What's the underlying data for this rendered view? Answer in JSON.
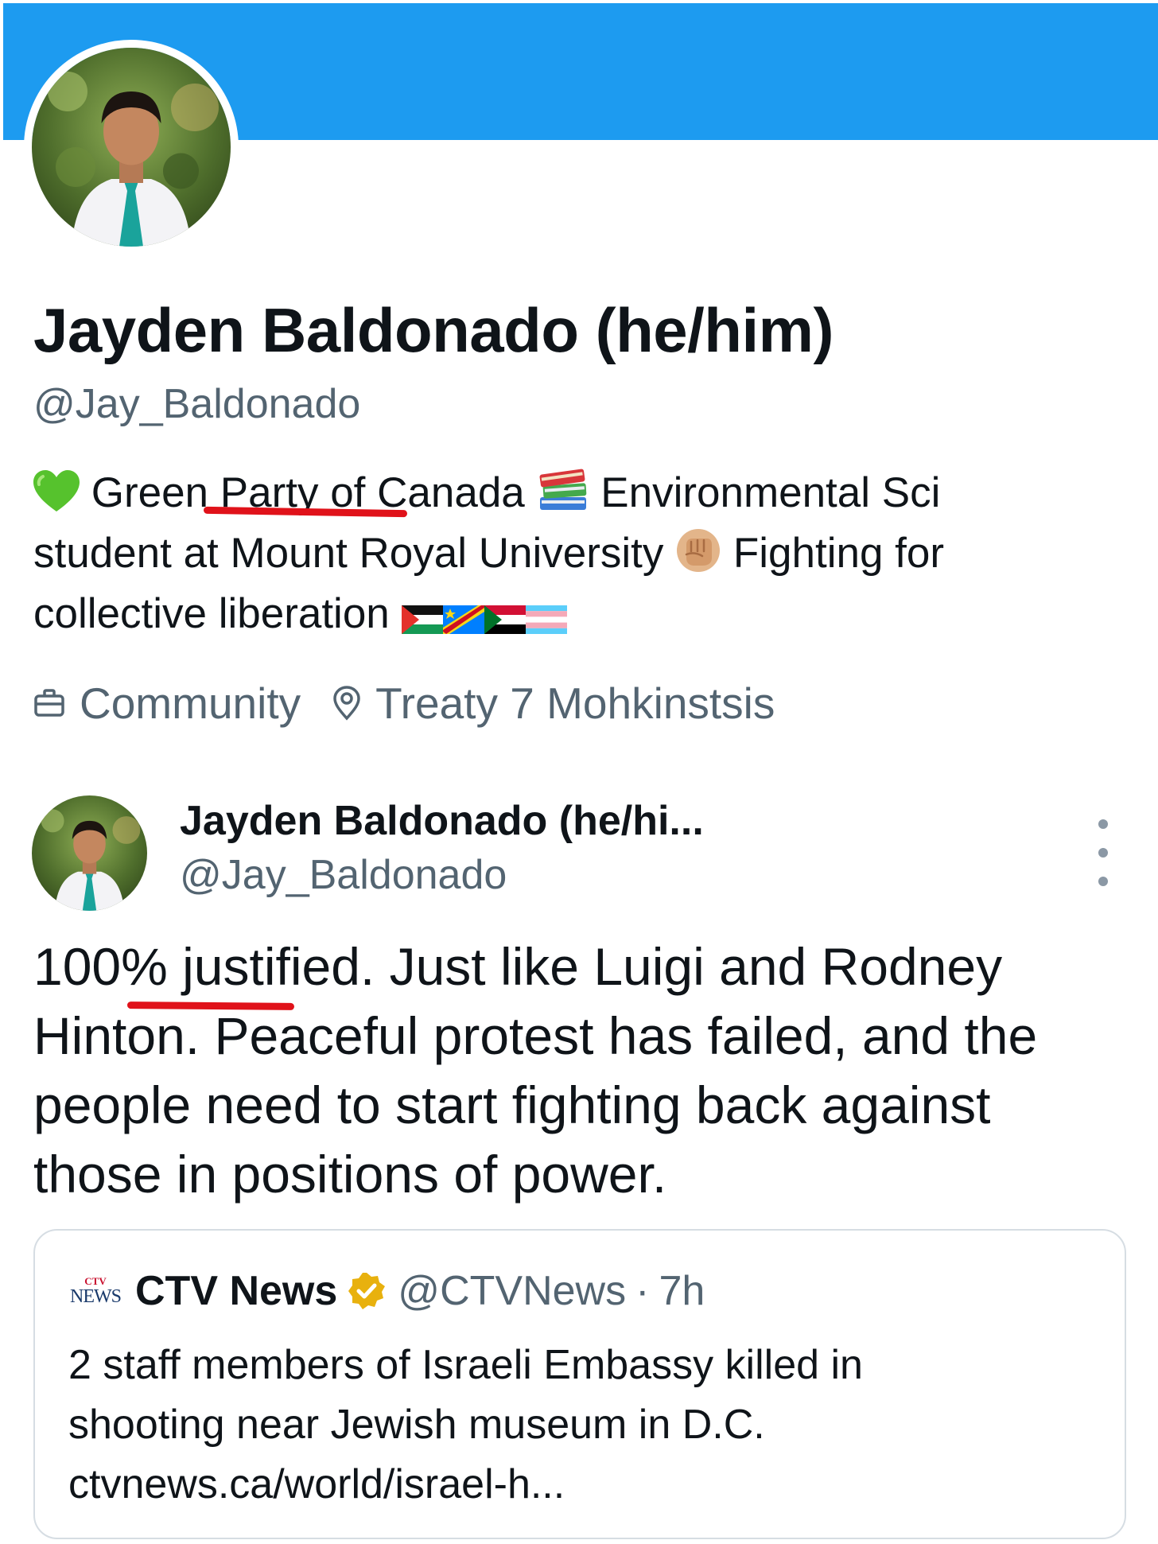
{
  "profile": {
    "display_name": "Jayden Baldonado (he/him)",
    "handle": "@Jay_Baldonado",
    "bio": {
      "line1": {
        "heart": "💚",
        "text_a": "Green Party of Canada",
        "books": "📚",
        "text_b": "Environmental Sci"
      },
      "line2": {
        "text_a": "student at Mount Royal University",
        "fist": "✊",
        "text_b": "Fighting for"
      },
      "line3": {
        "text_a": "collective liberation",
        "flags": [
          "Palestine",
          "DR Congo",
          "Sudan",
          "Transgender"
        ]
      }
    },
    "category": "Community",
    "location": "Treaty 7 Mohkinstsis",
    "category_icon": "briefcase-icon",
    "location_icon": "location-pin-icon"
  },
  "tweet": {
    "author_name": "Jayden Baldonado (he/hi...",
    "author_handle": "@Jay_Baldonado",
    "more_icon": "more-vertical-icon",
    "text_lines": [
      "100% justified. Just like Luigi and Rodney",
      "Hinton. Peaceful protest has failed, and the",
      "people need to start fighting back against",
      "those in positions of power."
    ],
    "quote": {
      "logo_top": "CTV",
      "logo_text": "NEWS",
      "name": "CTV News",
      "badge_icon": "verified-gold-badge-icon",
      "handle": "@CTVNews",
      "separator": "·",
      "time": "7h",
      "text_lines": [
        "2 staff members of Israeli Embassy killed in",
        "shooting near Jewish museum in D.C.",
        "ctvnews.ca/world/israel-h..."
      ]
    }
  },
  "colors": {
    "banner": "#1d9bf0",
    "secondary_text": "#536471",
    "annotation_underline": "#e0121a",
    "verified_badge": "#e8b10e"
  }
}
